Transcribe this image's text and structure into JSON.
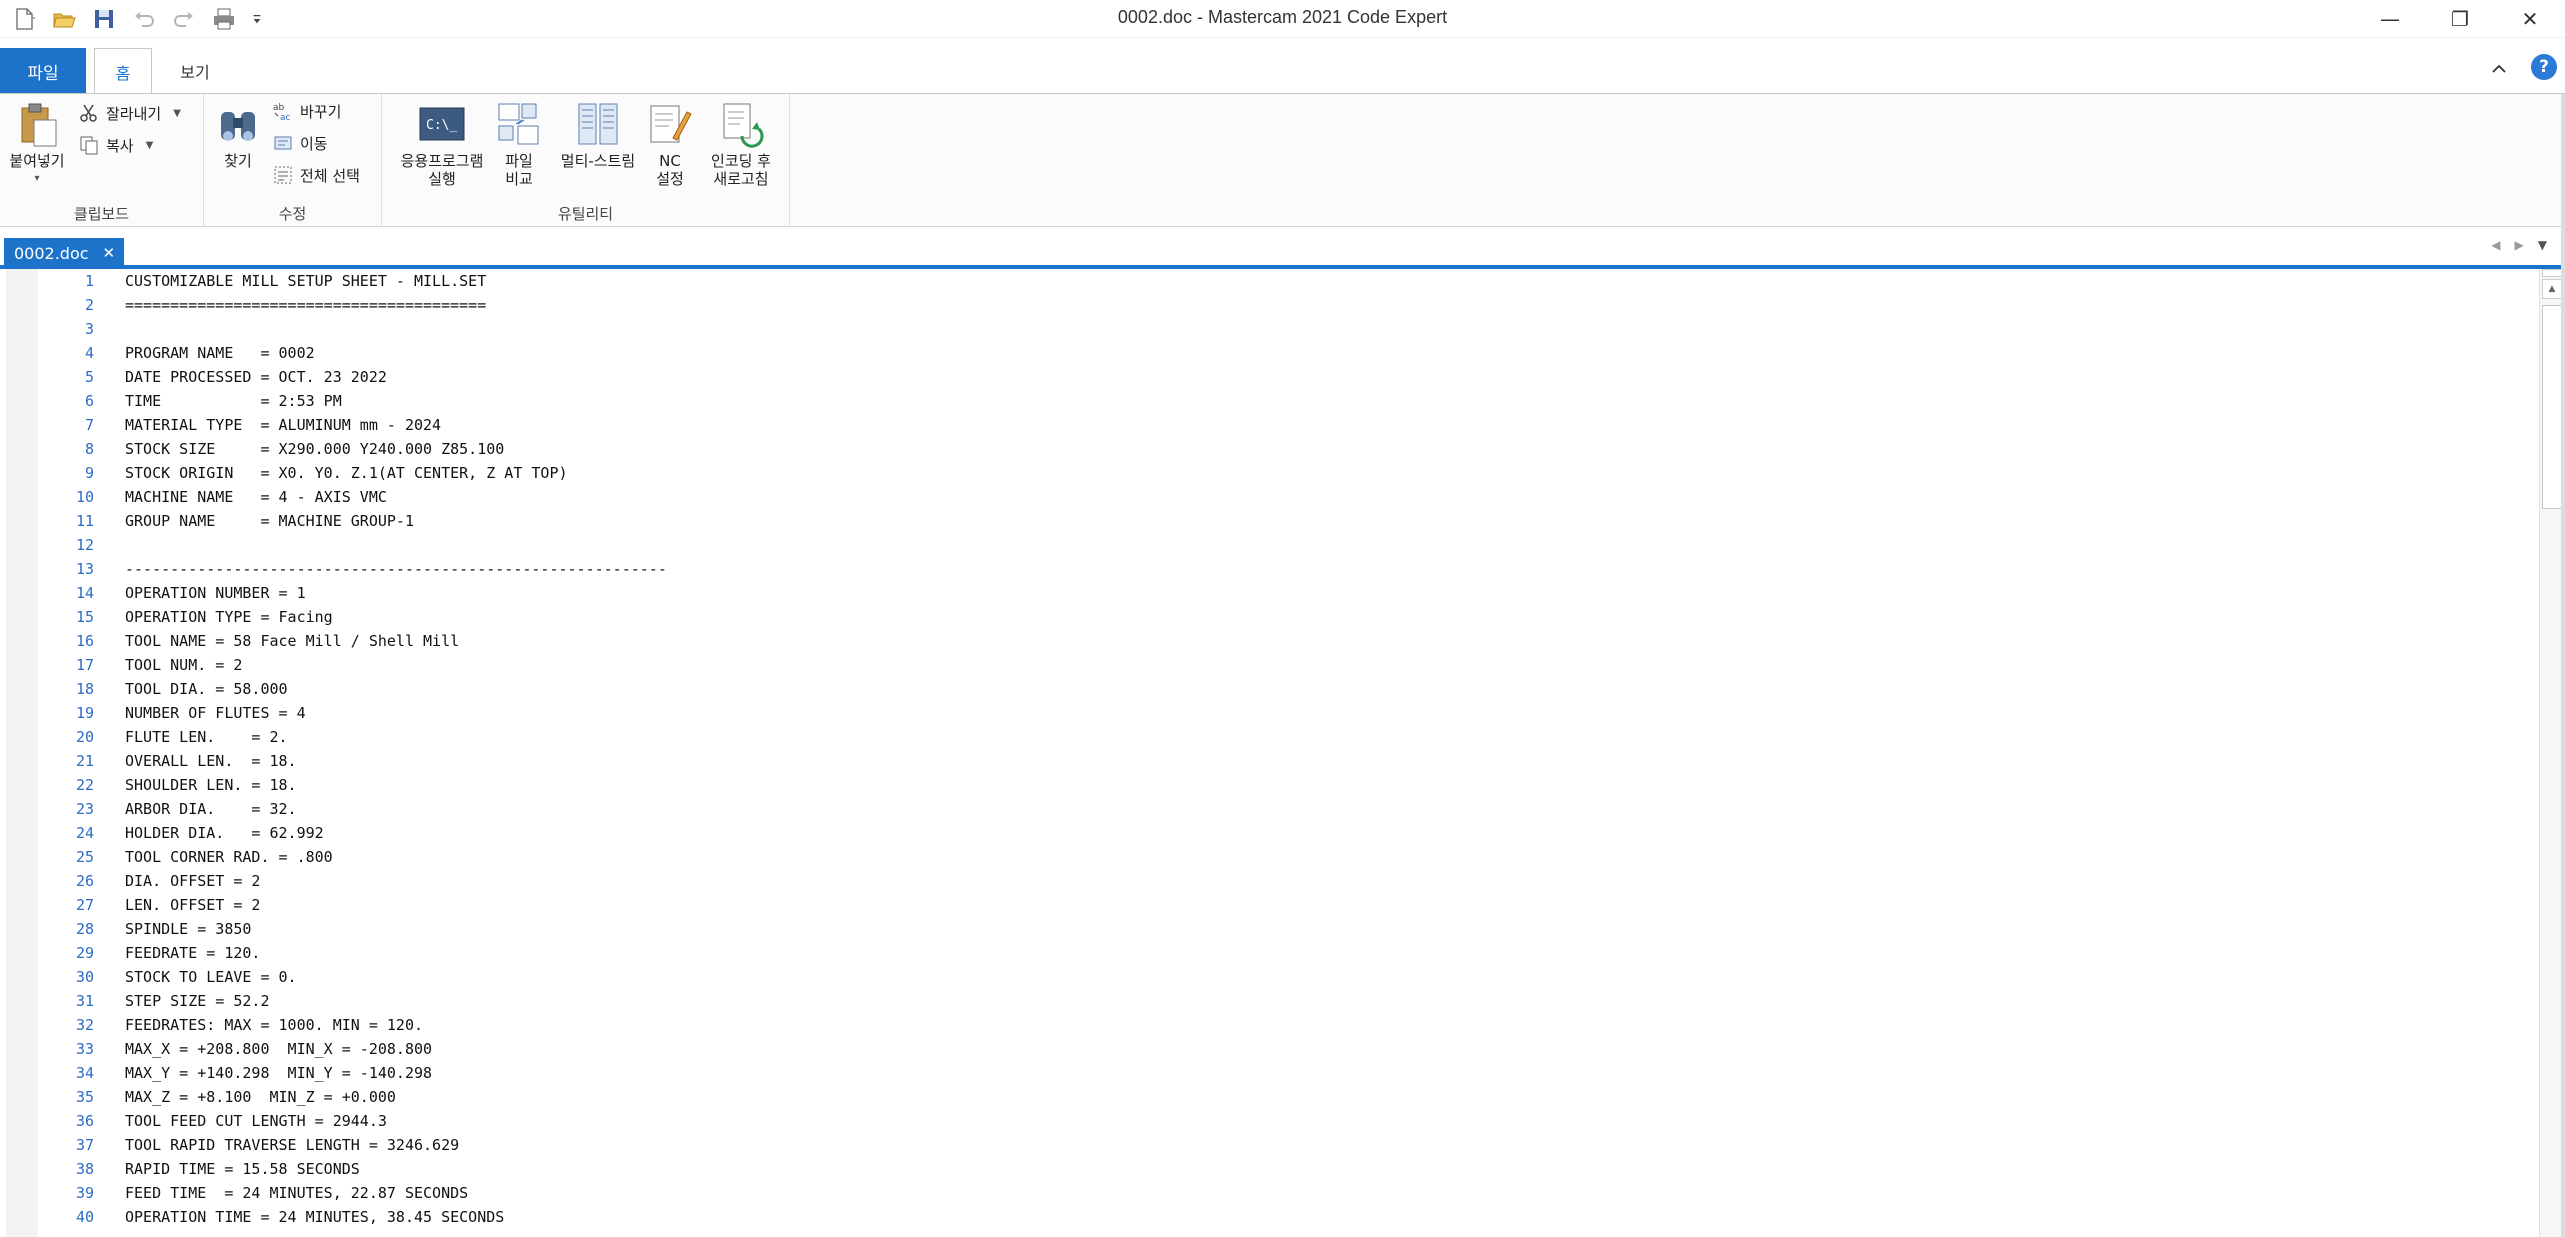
{
  "window": {
    "title": "0002.doc - Mastercam 2021 Code Expert",
    "minimize": "—",
    "restore": "❐",
    "close": "✕"
  },
  "ribbon_tabs": {
    "file": "파일",
    "home": "홈",
    "view": "보기",
    "collapse": "ˆ",
    "help": "?"
  },
  "clipboard": {
    "group_label": "클립보드",
    "paste": "붙여넣기",
    "cut": "잘라내기",
    "copy": "복사"
  },
  "edit": {
    "group_label": "수정",
    "find": "찾기",
    "replace": "바꾸기",
    "goto": "이동",
    "select_all": "전체 선택"
  },
  "utility": {
    "group_label": "유틸리티",
    "run_app_line1": "응용프로그램",
    "run_app_line2": "실행",
    "file_compare_line1": "파일",
    "file_compare_line2": "비교",
    "multistream": "멀티-스트림",
    "nc_line1": "NC",
    "nc_line2": "설정",
    "encode_line1": "인코딩 후",
    "encode_line2": "새로고침"
  },
  "doc_tab": {
    "name": "0002.doc",
    "close": "✕"
  },
  "editor_lines": [
    "CUSTOMIZABLE MILL SETUP SHEET - MILL.SET",
    "========================================",
    "",
    "PROGRAM NAME   = 0002",
    "DATE PROCESSED = OCT. 23 2022",
    "TIME           = 2:53 PM",
    "MATERIAL TYPE  = ALUMINUM mm - 2024",
    "STOCK SIZE     = X290.000 Y240.000 Z85.100",
    "STOCK ORIGIN   = X0. Y0. Z.1(AT CENTER, Z AT TOP)",
    "MACHINE NAME   = 4 - AXIS VMC",
    "GROUP NAME     = MACHINE GROUP-1",
    "",
    "------------------------------------------------------------",
    "OPERATION NUMBER = 1",
    "OPERATION TYPE = Facing",
    "TOOL NAME = 58 Face Mill / Shell Mill",
    "TOOL NUM. = 2",
    "TOOL DIA. = 58.000",
    "NUMBER OF FLUTES = 4",
    "FLUTE LEN.    = 2.",
    "OVERALL LEN.  = 18.",
    "SHOULDER LEN. = 18.",
    "ARBOR DIA.    = 32.",
    "HOLDER DIA.   = 62.992",
    "TOOL CORNER RAD. = .800",
    "DIA. OFFSET = 2",
    "LEN. OFFSET = 2",
    "SPINDLE = 3850",
    "FEEDRATE = 120.",
    "STOCK TO LEAVE = 0.",
    "STEP SIZE = 52.2",
    "FEEDRATES: MAX = 1000. MIN = 120.",
    "MAX_X = +208.800  MIN_X = -208.800",
    "MAX_Y = +140.298  MIN_Y = -140.298",
    "MAX_Z = +8.100  MIN_Z = +0.000",
    "TOOL FEED CUT LENGTH = 2944.3",
    "TOOL RAPID TRAVERSE LENGTH = 3246.629",
    "RAPID TIME = 15.58 SECONDS",
    "FEED TIME  = 24 MINUTES, 22.87 SECONDS",
    "OPERATION TIME = 24 MINUTES, 38.45 SECONDS"
  ]
}
